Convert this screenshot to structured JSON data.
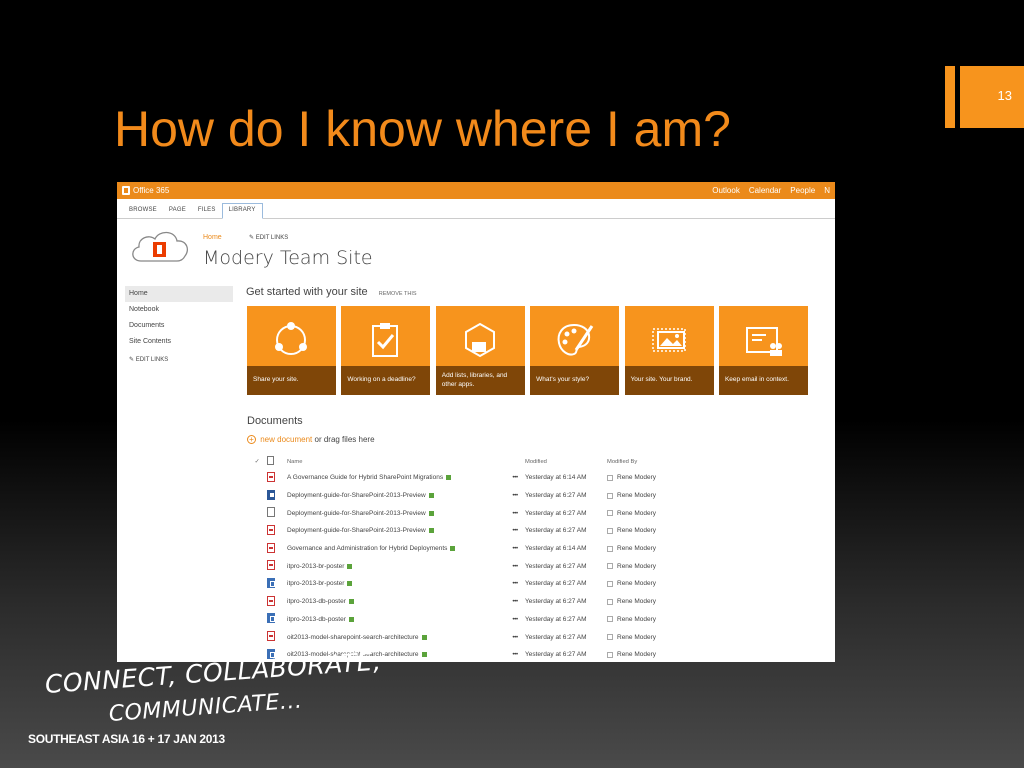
{
  "slide": {
    "title": "How do I know where I am?",
    "number": "13",
    "tagline_line1": "CONNECT, COLLABORATE,",
    "tagline_line2": "COMMUNICATE...",
    "event": "SOUTHEAST ASIA 16 + 17 JAN 2013",
    "accent_color": "#f7941d"
  },
  "suite_bar": {
    "brand": "Office 365",
    "links": [
      "Outlook",
      "Calendar",
      "People",
      "N"
    ]
  },
  "ribbon": {
    "tabs": [
      "BROWSE",
      "PAGE",
      "FILES",
      "LIBRARY"
    ],
    "active_tab": "FILES"
  },
  "site": {
    "breadcrumb_home": "Home",
    "edit_links": "EDIT LINKS",
    "title": "Modery Team Site"
  },
  "left_nav": {
    "items": [
      "Home",
      "Notebook",
      "Documents",
      "Site Contents"
    ],
    "selected": "Home",
    "edit_links": "EDIT LINKS"
  },
  "get_started": {
    "heading": "Get started with your site",
    "remove": "REMOVE THIS",
    "tiles": [
      {
        "label": "Share your site.",
        "icon": "share-circle-icon"
      },
      {
        "label": "Working on a deadline?",
        "icon": "clipboard-check-icon"
      },
      {
        "label": "Add lists, libraries, and other apps.",
        "icon": "app-hexagon-icon"
      },
      {
        "label": "What's your style?",
        "icon": "palette-icon"
      },
      {
        "label": "Your site. Your brand.",
        "icon": "picture-frame-icon"
      },
      {
        "label": "Keep email in context.",
        "icon": "contact-card-icon"
      }
    ]
  },
  "documents": {
    "heading": "Documents",
    "new_document": "new document",
    "drag_text": " or drag files here",
    "columns": {
      "name": "Name",
      "modified": "Modified",
      "modified_by": "Modified By"
    },
    "rows": [
      {
        "icon": "pdf",
        "name": "A Governance Guide for Hybrid SharePoint Migrations",
        "modified": "Yesterday at 6:14 AM",
        "by": "Rene Modery"
      },
      {
        "icon": "word",
        "name": "Deployment-guide-for-SharePoint-2013-Preview",
        "modified": "Yesterday at 6:27 AM",
        "by": "Rene Modery"
      },
      {
        "icon": "file",
        "name": "Deployment-guide-for-SharePoint-2013-Preview",
        "modified": "Yesterday at 6:27 AM",
        "by": "Rene Modery"
      },
      {
        "icon": "pdf",
        "name": "Deployment-guide-for-SharePoint-2013-Preview",
        "modified": "Yesterday at 6:27 AM",
        "by": "Rene Modery"
      },
      {
        "icon": "pdf",
        "name": "Governance and Administration for Hybrid Deployments",
        "modified": "Yesterday at 6:14 AM",
        "by": "Rene Modery"
      },
      {
        "icon": "pdf",
        "name": "itpro-2013-br-poster",
        "modified": "Yesterday at 6:27 AM",
        "by": "Rene Modery"
      },
      {
        "icon": "visio",
        "name": "itpro-2013-br-poster",
        "modified": "Yesterday at 6:27 AM",
        "by": "Rene Modery"
      },
      {
        "icon": "pdf",
        "name": "itpro-2013-db-poster",
        "modified": "Yesterday at 6:27 AM",
        "by": "Rene Modery"
      },
      {
        "icon": "visio",
        "name": "itpro-2013-db-poster",
        "modified": "Yesterday at 6:27 AM",
        "by": "Rene Modery"
      },
      {
        "icon": "pdf",
        "name": "oit2013-model-sharepoint-search-architecture",
        "modified": "Yesterday at 6:27 AM",
        "by": "Rene Modery"
      },
      {
        "icon": "visio",
        "name": "oit2013-model-sharepoint-search-architecture",
        "modified": "Yesterday at 6:27 AM",
        "by": "Rene Modery"
      }
    ]
  }
}
